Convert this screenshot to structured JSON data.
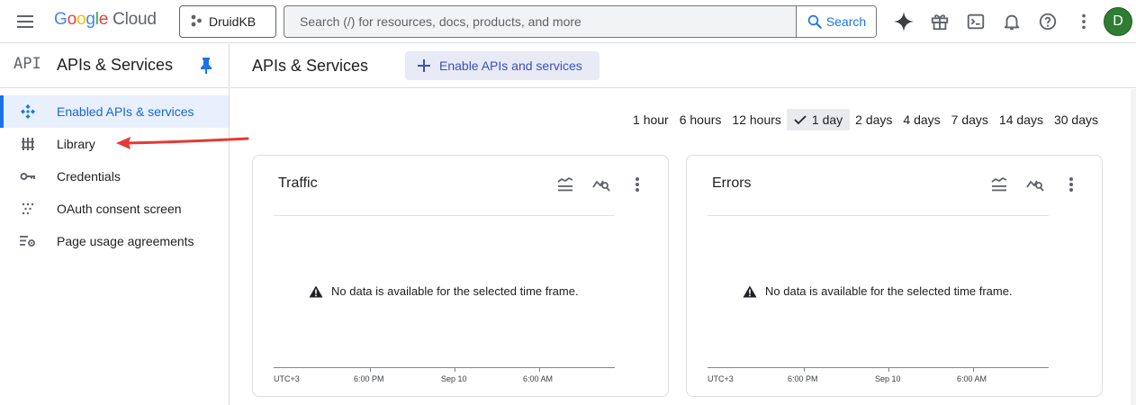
{
  "header": {
    "menu_icon": "hamburger-menu-icon",
    "logo": {
      "google": [
        "G",
        "o",
        "o",
        "g",
        "l",
        "e"
      ],
      "cloud": "Cloud"
    },
    "project": {
      "icon": "project-hierarchy-icon",
      "name": "DruidKB"
    },
    "search": {
      "placeholder": "Search (/) for resources, docs, products, and more",
      "value": "",
      "button_label": "Search",
      "button_icon": "search-icon"
    },
    "icons": [
      "gemini-sparkle-icon",
      "gift-icon",
      "cloud-shell-terminal-icon",
      "notifications-bell-icon",
      "help-icon",
      "more-vert-icon"
    ],
    "avatar_initial": "D",
    "accent": "#1a73e8",
    "avatar_color": "#2e7d32"
  },
  "sidebar": {
    "product_mark": "API",
    "title": "APIs & Services",
    "pin_icon": "pin-icon",
    "items": [
      {
        "label": "Enabled APIs & services",
        "icon": "enabled-apis-icon",
        "active": true
      },
      {
        "label": "Library",
        "icon": "library-icon",
        "active": false
      },
      {
        "label": "Credentials",
        "icon": "key-icon",
        "active": false
      },
      {
        "label": "OAuth consent screen",
        "icon": "oauth-dots-icon",
        "active": false
      },
      {
        "label": "Page usage agreements",
        "icon": "settings-list-icon",
        "active": false
      }
    ]
  },
  "main": {
    "title": "APIs & Services",
    "enable_button": {
      "icon": "plus-icon",
      "label": "Enable APIs and services"
    },
    "time_ranges": [
      {
        "label": "1 hour",
        "selected": false
      },
      {
        "label": "6 hours",
        "selected": false
      },
      {
        "label": "12 hours",
        "selected": false
      },
      {
        "label": "1 day",
        "selected": true
      },
      {
        "label": "2 days",
        "selected": false
      },
      {
        "label": "4 days",
        "selected": false
      },
      {
        "label": "7 days",
        "selected": false
      },
      {
        "label": "14 days",
        "selected": false
      },
      {
        "label": "30 days",
        "selected": false
      }
    ],
    "cards": [
      {
        "title": "Traffic",
        "tools": [
          "legend-toggle-icon",
          "explore-chart-icon",
          "more-vert-icon"
        ],
        "message": "No data is available for the selected time frame.",
        "message_icon": "warning-icon",
        "x_ticks": [
          "UTC+3",
          "6:00 PM",
          "Sep 10",
          "6:00 AM"
        ]
      },
      {
        "title": "Errors",
        "tools": [
          "legend-toggle-icon",
          "explore-chart-icon",
          "more-vert-icon"
        ],
        "message": "No data is available for the selected time frame.",
        "message_icon": "warning-icon",
        "x_ticks": [
          "UTC+3",
          "6:00 PM",
          "Sep 10",
          "6:00 AM"
        ]
      }
    ]
  },
  "annotation": {
    "type": "arrow",
    "color": "#e53935",
    "points_to": "Library"
  }
}
